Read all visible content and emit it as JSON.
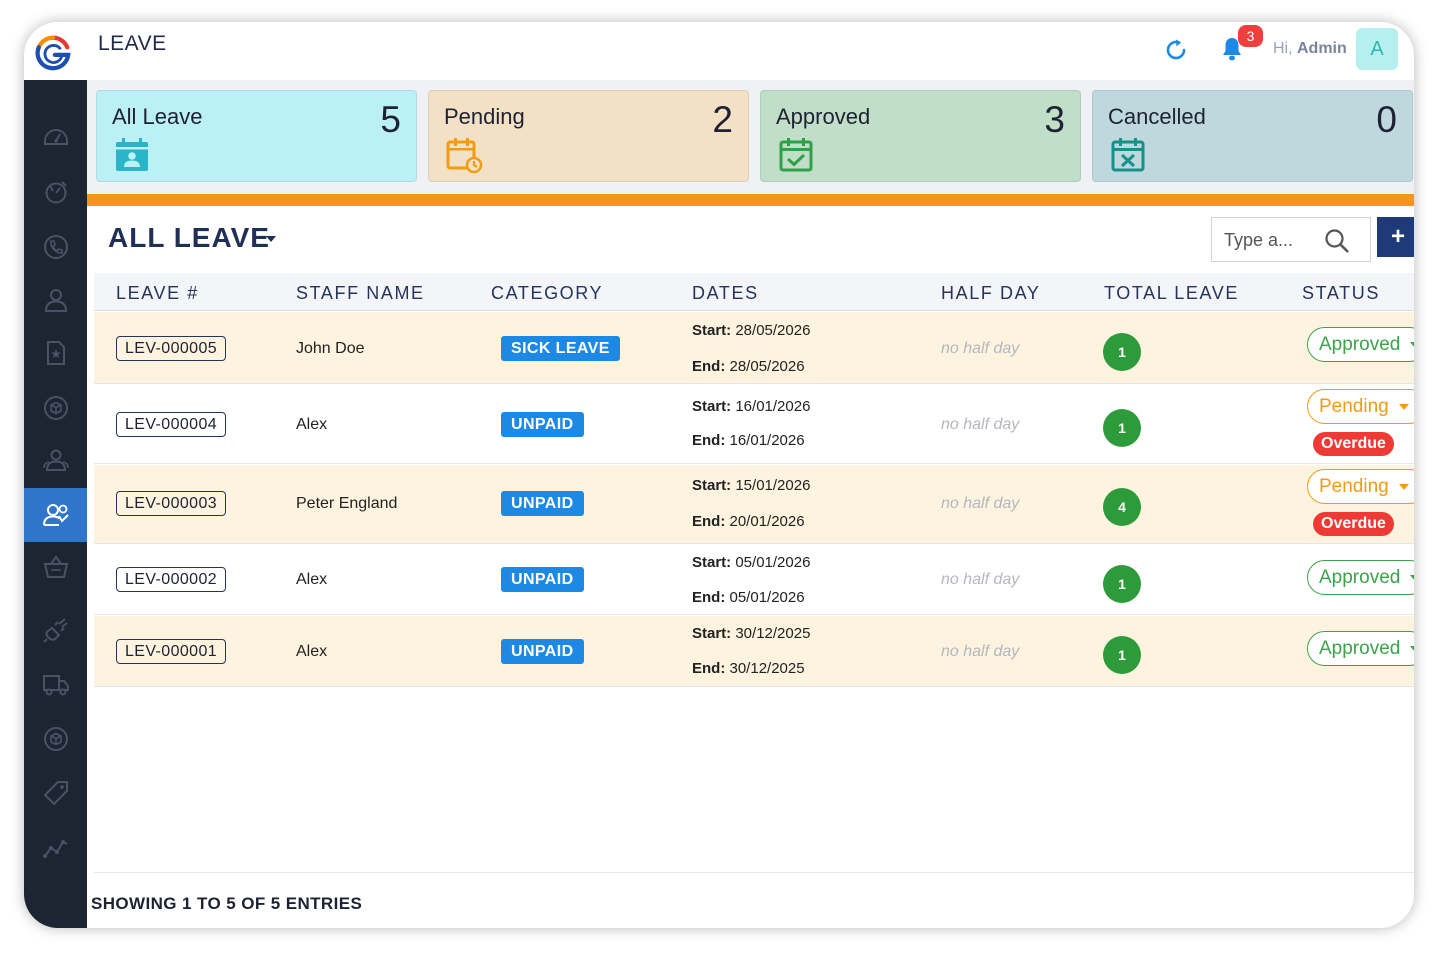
{
  "header": {
    "title": "LEAVE",
    "notification_count": "3",
    "greeting_prefix": "Hi, ",
    "greeting_name": "Admin",
    "avatar_initial": "A"
  },
  "sidebar": {
    "items": [
      {
        "icon": "dashboard-icon"
      },
      {
        "icon": "timer-icon"
      },
      {
        "icon": "phone-icon"
      },
      {
        "icon": "user-icon"
      },
      {
        "icon": "document-star-icon"
      },
      {
        "icon": "box-icon"
      },
      {
        "icon": "users-group-icon"
      },
      {
        "icon": "staff-icon",
        "active": true
      },
      {
        "icon": "basket-icon"
      },
      {
        "icon": "plug-icon"
      },
      {
        "icon": "truck-icon"
      },
      {
        "icon": "package-icon"
      },
      {
        "icon": "tag-icon"
      },
      {
        "icon": "chart-line-icon"
      }
    ]
  },
  "cards": [
    {
      "label": "All Leave",
      "count": "5",
      "bg": "#bcf0f7",
      "icon_color": "#2ab5c6"
    },
    {
      "label": "Pending",
      "count": "2",
      "bg": "#f3e1c6",
      "icon_color": "#f39c12"
    },
    {
      "label": "Approved",
      "count": "3",
      "bg": "#c1dfc8",
      "icon_color": "#2ea047"
    },
    {
      "label": "Cancelled",
      "count": "0",
      "bg": "#bed8de",
      "icon_color": "#17928a"
    }
  ],
  "list": {
    "title": "ALL LEAVE",
    "search_placeholder": "Type a...",
    "add_label": "+"
  },
  "table": {
    "columns": [
      "LEAVE #",
      "STAFF NAME",
      "CATEGORY",
      "DATES",
      "HALF DAY",
      "TOTAL LEAVE",
      "STATUS"
    ],
    "rows": [
      {
        "leave_no": "LEV-000005",
        "staff": "John Doe",
        "category": "SICK LEAVE",
        "start_label": "Start:",
        "start": "28/05/2026",
        "end_label": "End:",
        "end": "28/05/2026",
        "half_day": "no half day",
        "total": "1",
        "status": "Approved",
        "overdue": ""
      },
      {
        "leave_no": "LEV-000004",
        "staff": "Alex",
        "category": "UNPAID",
        "start_label": "Start:",
        "start": "16/01/2026",
        "end_label": "End:",
        "end": "16/01/2026",
        "half_day": "no half day",
        "total": "1",
        "status": "Pending",
        "overdue": "Overdue"
      },
      {
        "leave_no": "LEV-000003",
        "staff": "Peter England",
        "category": "UNPAID",
        "start_label": "Start:",
        "start": "15/01/2026",
        "end_label": "End:",
        "end": "20/01/2026",
        "half_day": "no half day",
        "total": "4",
        "status": "Pending",
        "overdue": "Overdue"
      },
      {
        "leave_no": "LEV-000002",
        "staff": "Alex",
        "category": "UNPAID",
        "start_label": "Start:",
        "start": "05/01/2026",
        "end_label": "End:",
        "end": "05/01/2026",
        "half_day": "no half day",
        "total": "1",
        "status": "Approved",
        "overdue": ""
      },
      {
        "leave_no": "LEV-000001",
        "staff": "Alex",
        "category": "UNPAID",
        "start_label": "Start:",
        "start": "30/12/2025",
        "end_label": "End:",
        "end": "30/12/2025",
        "half_day": "no half day",
        "total": "1",
        "status": "Approved",
        "overdue": ""
      }
    ]
  },
  "footer": {
    "entries_text": "SHOWING 1 TO 5 OF 5 ENTRIES"
  },
  "colors": {
    "accent_orange": "#f7941d",
    "sidebar_bg": "#1d2432",
    "sidebar_active": "#2f75c9",
    "primary_dark": "#1f3a78",
    "category_blue": "#1e88e5",
    "approved_green": "#3da34a",
    "pending_orange": "#f39c12",
    "overdue_red": "#ee3a35"
  }
}
